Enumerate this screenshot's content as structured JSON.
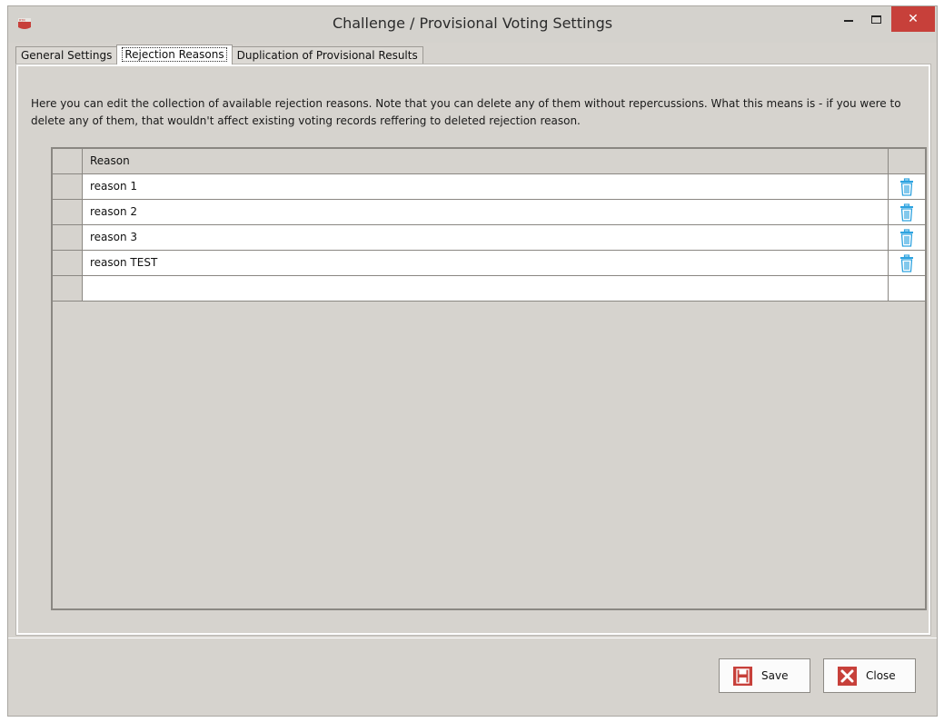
{
  "window": {
    "title": "Challenge / Provisional Voting Settings",
    "app_icon": "rtr-app-icon",
    "controls": [
      "minimize-icon",
      "maximize-icon",
      "close-icon"
    ]
  },
  "tabs": [
    {
      "label": "General Settings",
      "active": false
    },
    {
      "label": "Rejection Reasons",
      "active": true
    },
    {
      "label": "Duplication of Provisional Results",
      "active": false
    }
  ],
  "panel": {
    "description": "Here you can edit the collection of available rejection reasons. Note that you can delete any of them without repercussions. What this means is - if you were to delete any of them, that wouldn't affect existing voting records reffering to deleted rejection reason."
  },
  "grid": {
    "column_header": "Reason",
    "rows": [
      {
        "reason": "reason 1",
        "icon": "trash-icon"
      },
      {
        "reason": "reason 2",
        "icon": "trash-icon"
      },
      {
        "reason": "reason 3",
        "icon": "trash-icon"
      },
      {
        "reason": "reason TEST",
        "icon": "trash-icon"
      }
    ],
    "new_row_value": ""
  },
  "buttons": {
    "save": {
      "label": "Save",
      "icon": "save-icon"
    },
    "close": {
      "label": "Close",
      "icon": "close-x-icon"
    }
  },
  "colors": {
    "accent_red": "#c7403a",
    "trash_blue": "#2ea3e0",
    "panel_bg": "#d6d3ce"
  }
}
